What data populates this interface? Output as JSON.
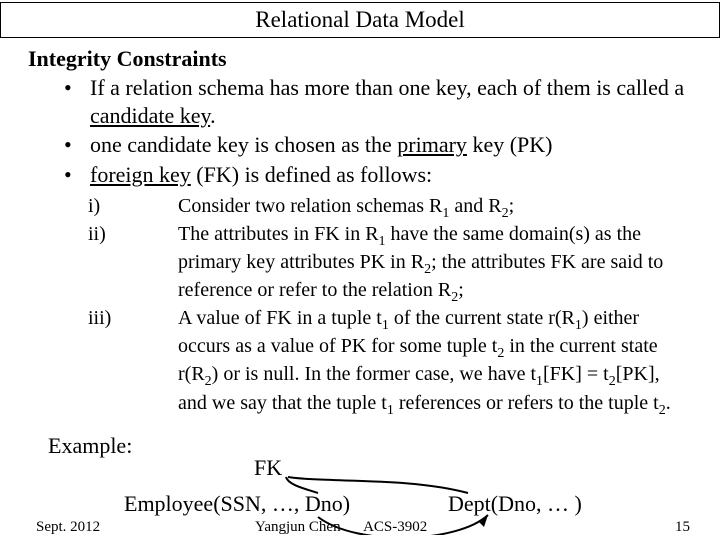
{
  "title": "Relational Data Model",
  "heading": "Integrity Constraints",
  "bullets": {
    "b1_pre": "If a relation schema has more than one key, each of them is called a ",
    "b1_ul": "candidate key",
    "b1_post": ".",
    "b2_pre": "one candidate key is chosen as the ",
    "b2_ul": "primary",
    "b2_post": " key (PK)",
    "b3_ul": "foreign key",
    "b3_post": " (FK) is defined as follows:"
  },
  "roman": {
    "i_num": "i)",
    "i_txt_a": "Consider two relation schemas R",
    "i_txt_b": " and R",
    "i_txt_c": ";",
    "ii_num": "ii)",
    "ii_txt_a": "The attributes in FK in R",
    "ii_txt_b": " have the same domain(s) as the primary key attributes PK in R",
    "ii_txt_c": "; the attributes FK are said to reference or refer to the relation R",
    "ii_txt_d": ";",
    "iii_num": "iii)",
    "iii_txt_a": "A value of FK in a tuple t",
    "iii_txt_b": " of the current state r(R",
    "iii_txt_c": ") either occurs as a value of PK for some tuple t",
    "iii_txt_d": " in the current state r(R",
    "iii_txt_e": ") or is null. In the former case, we have t",
    "iii_txt_f": "[FK] = t",
    "iii_txt_g": "[PK], and we say that the tuple t",
    "iii_txt_h": " references or refers to the tuple t",
    "iii_txt_i": "."
  },
  "sub": {
    "one": "1",
    "two": "2"
  },
  "example_label": "Example:",
  "diagram": {
    "fk": "FK",
    "emp": "Employee(SSN, …, Dno)",
    "dept": "Dept(Dno, … )"
  },
  "footer": {
    "date": "Sept. 2012",
    "mid_author": "Yangjun Chen",
    "mid_course": "ACS-3902",
    "page": "15"
  }
}
